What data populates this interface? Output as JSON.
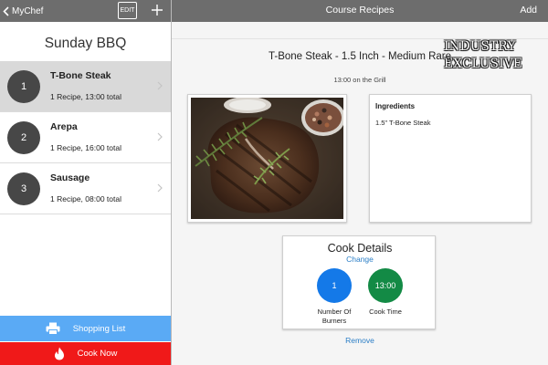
{
  "left_nav": {
    "back_label": "MyChef",
    "edit_label": "EDIT",
    "add_icon": "plus-icon"
  },
  "right_nav": {
    "title": "Course Recipes",
    "add_label": "Add"
  },
  "sidebar": {
    "title": "Sunday BBQ",
    "courses": [
      {
        "number": "1",
        "name": "T-Bone Steak",
        "summary": "1 Recipe,  13:00 total",
        "selected": true
      },
      {
        "number": "2",
        "name": "Arepa",
        "summary": "1 Recipe,  16:00 total",
        "selected": false
      },
      {
        "number": "3",
        "name": "Sausage",
        "summary": "1 Recipe,  08:00 total",
        "selected": false
      }
    ],
    "shopping_list_label": "Shopping List",
    "cook_now_label": "Cook Now"
  },
  "watermark": {
    "line1": "INDUSTRY",
    "line2": "EXCLUSIVE"
  },
  "recipe": {
    "title": "T-Bone Steak - 1.5 Inch - Medium Rare",
    "time_note": "13:00 on the Grill",
    "ingredients_heading": "Ingredients",
    "ingredients": [
      "1.5\" T-Bone Steak"
    ]
  },
  "cook_details": {
    "heading": "Cook Details",
    "change_label": "Change",
    "burners_value": "1",
    "burners_label_1": "Number Of",
    "burners_label_2": "Burners",
    "time_value": "13:00",
    "time_label": "Cook Time"
  },
  "remove_label": "Remove",
  "colors": {
    "nav_bar": "#6d6d6d",
    "selected_row": "#d9d9d9",
    "shopping_button": "#5aaaf5",
    "cook_button": "#f01919",
    "burners_circle": "#1479e8",
    "time_circle": "#138a45",
    "link": "#2a7ec6"
  }
}
